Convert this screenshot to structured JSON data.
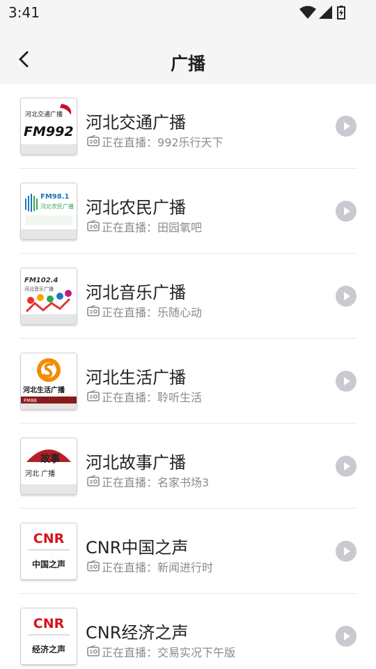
{
  "status": {
    "time": "3:41"
  },
  "header": {
    "title": "广播"
  },
  "live_prefix": "正在直播：",
  "stations": [
    {
      "name": "河北交通广播",
      "program": "992乐行天下",
      "logo_text": "FM992",
      "logo_caption": "河北交通广播"
    },
    {
      "name": "河北农民广播",
      "program": "田园氧吧",
      "logo_text": "FM98.1",
      "logo_caption": "河北农民广播"
    },
    {
      "name": "河北音乐广播",
      "program": "乐随心动",
      "logo_text": "FM102.4",
      "logo_caption": "河北音乐广播"
    },
    {
      "name": "河北生活广播",
      "program": "聆听生活",
      "logo_text": "河北生活广播",
      "logo_caption": "FM88"
    },
    {
      "name": "河北故事广播",
      "program": "名家书场3",
      "logo_text": "故事",
      "logo_caption": "河北 广播"
    },
    {
      "name": "CNR中国之声",
      "program": "新闻进行时",
      "logo_text": "CNR",
      "logo_caption": "中国之声"
    },
    {
      "name": "CNR经济之声",
      "program": "交易实况下午版",
      "logo_text": "CNR",
      "logo_caption": "经济之声"
    }
  ],
  "colors": {
    "play_button": "#c9c9cf",
    "cnr_red": "#d7141a"
  }
}
